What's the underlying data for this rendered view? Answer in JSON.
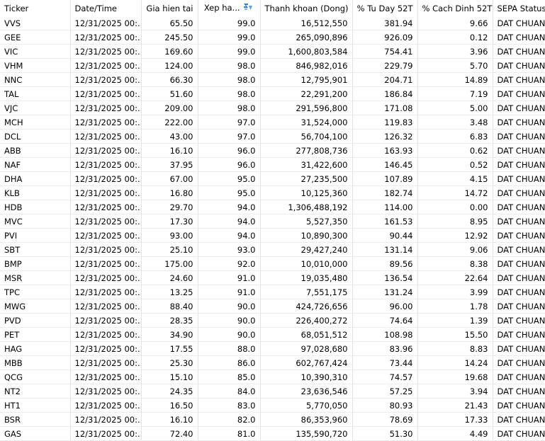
{
  "columns": [
    {
      "key": "ticker",
      "label": "Ticker"
    },
    {
      "key": "datetime",
      "label": "Date/Time"
    },
    {
      "key": "price",
      "label": "Gia hien tai"
    },
    {
      "key": "rank",
      "label": "Xep ha..."
    },
    {
      "key": "sort",
      "label": ""
    },
    {
      "key": "liquidity",
      "label": "Thanh khoan (Dong)"
    },
    {
      "key": "from_low",
      "label": "% Tu Day 52T"
    },
    {
      "key": "from_high",
      "label": "% Cach Dinh 52T"
    },
    {
      "key": "sepa",
      "label": "SEPA Status"
    }
  ],
  "sort_icon": "sort-descending-icon",
  "rows": [
    {
      "ticker": "VVS",
      "datetime": "12/31/2025 00:...",
      "price": "65.50",
      "rank": "99.0",
      "liquidity": "16,512,550",
      "from_low": "381.94",
      "from_high": "9.66",
      "sepa": "DAT CHUAN"
    },
    {
      "ticker": "GEE",
      "datetime": "12/31/2025 00:...",
      "price": "245.50",
      "rank": "99.0",
      "liquidity": "265,090,896",
      "from_low": "926.09",
      "from_high": "0.12",
      "sepa": "DAT CHUAN"
    },
    {
      "ticker": "VIC",
      "datetime": "12/31/2025 00:...",
      "price": "169.60",
      "rank": "99.0",
      "liquidity": "1,600,803,584",
      "from_low": "754.41",
      "from_high": "3.96",
      "sepa": "DAT CHUAN"
    },
    {
      "ticker": "VHM",
      "datetime": "12/31/2025 00:...",
      "price": "124.00",
      "rank": "98.0",
      "liquidity": "846,982,016",
      "from_low": "229.79",
      "from_high": "5.70",
      "sepa": "DAT CHUAN"
    },
    {
      "ticker": "NNC",
      "datetime": "12/31/2025 00:...",
      "price": "66.30",
      "rank": "98.0",
      "liquidity": "12,795,901",
      "from_low": "204.71",
      "from_high": "14.89",
      "sepa": "DAT CHUAN"
    },
    {
      "ticker": "TAL",
      "datetime": "12/31/2025 00:...",
      "price": "51.60",
      "rank": "98.0",
      "liquidity": "22,291,200",
      "from_low": "186.84",
      "from_high": "7.19",
      "sepa": "DAT CHUAN"
    },
    {
      "ticker": "VJC",
      "datetime": "12/31/2025 00:...",
      "price": "209.00",
      "rank": "98.0",
      "liquidity": "291,596,800",
      "from_low": "171.08",
      "from_high": "5.00",
      "sepa": "DAT CHUAN"
    },
    {
      "ticker": "MCH",
      "datetime": "12/31/2025 00:...",
      "price": "222.00",
      "rank": "97.0",
      "liquidity": "31,524,000",
      "from_low": "119.83",
      "from_high": "3.48",
      "sepa": "DAT CHUAN"
    },
    {
      "ticker": "DCL",
      "datetime": "12/31/2025 00:...",
      "price": "43.00",
      "rank": "97.0",
      "liquidity": "56,704,100",
      "from_low": "126.32",
      "from_high": "6.83",
      "sepa": "DAT CHUAN"
    },
    {
      "ticker": "ABB",
      "datetime": "12/31/2025 00:...",
      "price": "16.10",
      "rank": "96.0",
      "liquidity": "277,808,736",
      "from_low": "163.93",
      "from_high": "0.62",
      "sepa": "DAT CHUAN"
    },
    {
      "ticker": "NAF",
      "datetime": "12/31/2025 00:...",
      "price": "37.95",
      "rank": "96.0",
      "liquidity": "31,422,600",
      "from_low": "146.45",
      "from_high": "0.52",
      "sepa": "DAT CHUAN"
    },
    {
      "ticker": "DHA",
      "datetime": "12/31/2025 00:...",
      "price": "67.00",
      "rank": "95.0",
      "liquidity": "27,235,500",
      "from_low": "107.89",
      "from_high": "4.15",
      "sepa": "DAT CHUAN"
    },
    {
      "ticker": "KLB",
      "datetime": "12/31/2025 00:...",
      "price": "16.80",
      "rank": "95.0",
      "liquidity": "10,125,360",
      "from_low": "182.74",
      "from_high": "14.72",
      "sepa": "DAT CHUAN"
    },
    {
      "ticker": "HDB",
      "datetime": "12/31/2025 00:...",
      "price": "29.70",
      "rank": "94.0",
      "liquidity": "1,306,488,192",
      "from_low": "114.00",
      "from_high": "0.00",
      "sepa": "DAT CHUAN"
    },
    {
      "ticker": "MVC",
      "datetime": "12/31/2025 00:...",
      "price": "17.30",
      "rank": "94.0",
      "liquidity": "5,527,350",
      "from_low": "161.53",
      "from_high": "8.95",
      "sepa": "DAT CHUAN"
    },
    {
      "ticker": "PVI",
      "datetime": "12/31/2025 00:...",
      "price": "93.00",
      "rank": "94.0",
      "liquidity": "10,890,300",
      "from_low": "90.44",
      "from_high": "12.92",
      "sepa": "DAT CHUAN"
    },
    {
      "ticker": "SBT",
      "datetime": "12/31/2025 00:...",
      "price": "25.10",
      "rank": "93.0",
      "liquidity": "29,427,240",
      "from_low": "131.14",
      "from_high": "9.06",
      "sepa": "DAT CHUAN"
    },
    {
      "ticker": "BMP",
      "datetime": "12/31/2025 00:...",
      "price": "175.00",
      "rank": "92.0",
      "liquidity": "10,010,000",
      "from_low": "89.56",
      "from_high": "8.38",
      "sepa": "DAT CHUAN"
    },
    {
      "ticker": "MSR",
      "datetime": "12/31/2025 00:...",
      "price": "24.60",
      "rank": "91.0",
      "liquidity": "19,035,480",
      "from_low": "136.54",
      "from_high": "22.64",
      "sepa": "DAT CHUAN"
    },
    {
      "ticker": "TPC",
      "datetime": "12/31/2025 00:...",
      "price": "13.25",
      "rank": "91.0",
      "liquidity": "7,551,175",
      "from_low": "131.24",
      "from_high": "3.99",
      "sepa": "DAT CHUAN"
    },
    {
      "ticker": "MWG",
      "datetime": "12/31/2025 00:...",
      "price": "88.40",
      "rank": "90.0",
      "liquidity": "424,726,656",
      "from_low": "96.00",
      "from_high": "1.78",
      "sepa": "DAT CHUAN"
    },
    {
      "ticker": "PVD",
      "datetime": "12/31/2025 00:...",
      "price": "28.35",
      "rank": "90.0",
      "liquidity": "226,400,272",
      "from_low": "74.64",
      "from_high": "1.39",
      "sepa": "DAT CHUAN"
    },
    {
      "ticker": "PET",
      "datetime": "12/31/2025 00:...",
      "price": "34.90",
      "rank": "90.0",
      "liquidity": "68,051,512",
      "from_low": "108.98",
      "from_high": "15.50",
      "sepa": "DAT CHUAN"
    },
    {
      "ticker": "HAG",
      "datetime": "12/31/2025 00:...",
      "price": "17.55",
      "rank": "88.0",
      "liquidity": "97,028,680",
      "from_low": "83.96",
      "from_high": "8.83",
      "sepa": "DAT CHUAN"
    },
    {
      "ticker": "MBB",
      "datetime": "12/31/2025 00:...",
      "price": "25.30",
      "rank": "86.0",
      "liquidity": "602,767,424",
      "from_low": "73.44",
      "from_high": "14.24",
      "sepa": "DAT CHUAN"
    },
    {
      "ticker": "QCG",
      "datetime": "12/31/2025 00:...",
      "price": "15.10",
      "rank": "85.0",
      "liquidity": "10,390,310",
      "from_low": "74.57",
      "from_high": "19.68",
      "sepa": "DAT CHUAN"
    },
    {
      "ticker": "NT2",
      "datetime": "12/31/2025 00:...",
      "price": "24.35",
      "rank": "84.0",
      "liquidity": "23,636,546",
      "from_low": "57.25",
      "from_high": "3.94",
      "sepa": "DAT CHUAN"
    },
    {
      "ticker": "HT1",
      "datetime": "12/31/2025 00:...",
      "price": "16.50",
      "rank": "83.0",
      "liquidity": "5,770,050",
      "from_low": "80.93",
      "from_high": "21.43",
      "sepa": "DAT CHUAN"
    },
    {
      "ticker": "BSR",
      "datetime": "12/31/2025 00:...",
      "price": "16.10",
      "rank": "82.0",
      "liquidity": "86,353,960",
      "from_low": "78.69",
      "from_high": "17.33",
      "sepa": "DAT CHUAN"
    },
    {
      "ticker": "GAS",
      "datetime": "12/31/2025 00:...",
      "price": "72.40",
      "rank": "81.0",
      "liquidity": "135,590,720",
      "from_low": "51.30",
      "from_high": "4.49",
      "sepa": "DAT CHUAN"
    }
  ]
}
